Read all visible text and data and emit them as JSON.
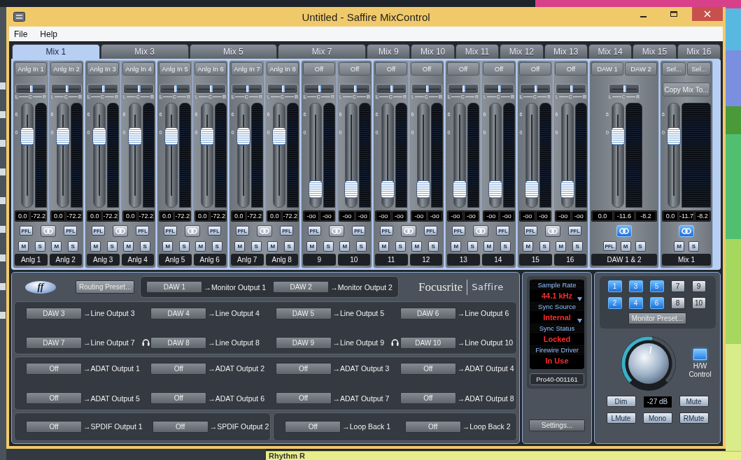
{
  "window": {
    "title": "Untitled - Saffire MixControl"
  },
  "menu": [
    "File",
    "Help"
  ],
  "tabs": [
    {
      "label": "Mix 1",
      "selected": true
    },
    {
      "label": "Mix 3",
      "selected": false
    },
    {
      "label": "Mix 5",
      "selected": false
    },
    {
      "label": "Mix 7",
      "selected": false
    },
    {
      "label": "Mix 9",
      "selected": false
    },
    {
      "label": "Mix 10",
      "selected": false
    },
    {
      "label": "Mix 11",
      "selected": false
    },
    {
      "label": "Mix 12",
      "selected": false
    },
    {
      "label": "Mix 13",
      "selected": false
    },
    {
      "label": "Mix 14",
      "selected": false
    },
    {
      "label": "Mix 15",
      "selected": false
    },
    {
      "label": "Mix 16",
      "selected": false
    }
  ],
  "mixer": {
    "groups": [
      {
        "kind": "pair",
        "linked": false,
        "strips": [
          {
            "sources": [
              "Anlg In 1"
            ],
            "pan": {
              "level": 0.5
            },
            "pan_labels": [
              "L",
              "C",
              "R"
            ],
            "fader_scale": [
              "6",
              "0"
            ],
            "level": 0.72,
            "readouts": [
              "0.0",
              "-72.2"
            ],
            "pfl": "PFL",
            "mute": "M",
            "solo": "S",
            "name": "Anlg 1"
          },
          {
            "sources": [
              "Anlg In 2"
            ],
            "pan": {
              "level": 0.5
            },
            "pan_labels": [
              "L",
              "C",
              "R"
            ],
            "fader_scale": [
              "6",
              "0"
            ],
            "level": 0.72,
            "readouts": [
              "0.0",
              "-72.2"
            ],
            "pfl": "PFL",
            "mute": "M",
            "solo": "S",
            "name": "Anlg 2"
          }
        ]
      },
      {
        "kind": "pair",
        "linked": false,
        "strips": [
          {
            "sources": [
              "Anlg In 3"
            ],
            "pan": {
              "level": 0.5
            },
            "pan_labels": [
              "L",
              "C",
              "R"
            ],
            "fader_scale": [
              "6",
              "0"
            ],
            "level": 0.72,
            "readouts": [
              "0.0",
              "-72.2"
            ],
            "pfl": "PFL",
            "mute": "M",
            "solo": "S",
            "name": "Anlg 3"
          },
          {
            "sources": [
              "Anlg In 4"
            ],
            "pan": {
              "level": 0.5
            },
            "pan_labels": [
              "L",
              "C",
              "R"
            ],
            "fader_scale": [
              "6",
              "0"
            ],
            "level": 0.72,
            "readouts": [
              "0.0",
              "-72.2"
            ],
            "pfl": "PFL",
            "mute": "M",
            "solo": "S",
            "name": "Anlg 4"
          }
        ]
      },
      {
        "kind": "pair",
        "linked": false,
        "strips": [
          {
            "sources": [
              "Anlg In 5"
            ],
            "pan": {
              "level": 0.5
            },
            "pan_labels": [
              "L",
              "C",
              "R"
            ],
            "fader_scale": [
              "6",
              "0"
            ],
            "level": 0.72,
            "readouts": [
              "0.0",
              "-72.2"
            ],
            "pfl": "PFL",
            "mute": "M",
            "solo": "S",
            "name": "Anlg 5"
          },
          {
            "sources": [
              "Anlg In 6"
            ],
            "pan": {
              "level": 0.5
            },
            "pan_labels": [
              "L",
              "C",
              "R"
            ],
            "fader_scale": [
              "6",
              "0"
            ],
            "level": 0.72,
            "readouts": [
              "0.0",
              "-72.2"
            ],
            "pfl": "PFL",
            "mute": "M",
            "solo": "S",
            "name": "Anlg 6"
          }
        ]
      },
      {
        "kind": "pair",
        "linked": false,
        "strips": [
          {
            "sources": [
              "Anlg In 7"
            ],
            "pan": {
              "level": 0.5
            },
            "pan_labels": [
              "L",
              "C",
              "R"
            ],
            "fader_scale": [
              "6",
              "0"
            ],
            "level": 0.72,
            "readouts": [
              "0.0",
              "-72.2"
            ],
            "pfl": "PFL",
            "mute": "M",
            "solo": "S",
            "name": "Anlg 7"
          },
          {
            "sources": [
              "Anlg In 8"
            ],
            "pan": {
              "level": 0.5
            },
            "pan_labels": [
              "L",
              "C",
              "R"
            ],
            "fader_scale": [
              "6",
              "0"
            ],
            "level": 0.72,
            "readouts": [
              "0.0",
              "-72.2"
            ],
            "pfl": "PFL",
            "mute": "M",
            "solo": "S",
            "name": "Anlg 8"
          }
        ]
      },
      {
        "kind": "pair",
        "linked": false,
        "strips": [
          {
            "sources": [
              "Off"
            ],
            "pan": {
              "level": 0.5
            },
            "pan_labels": [
              "L",
              "C",
              "R"
            ],
            "fader_scale": [
              "6",
              "0"
            ],
            "level": 0.1,
            "readouts": [
              "-oo",
              "-oo"
            ],
            "pfl": "PFL",
            "mute": "M",
            "solo": "S",
            "name": "9"
          },
          {
            "sources": [
              "Off"
            ],
            "pan": {
              "level": 0.5
            },
            "pan_labels": [
              "L",
              "C",
              "R"
            ],
            "fader_scale": [
              "6",
              "0"
            ],
            "level": 0.1,
            "readouts": [
              "-oo",
              "-oo"
            ],
            "pfl": "PFL",
            "mute": "M",
            "solo": "S",
            "name": "10"
          }
        ]
      },
      {
        "kind": "pair",
        "linked": false,
        "strips": [
          {
            "sources": [
              "Off"
            ],
            "pan": {
              "level": 0.5
            },
            "pan_labels": [
              "L",
              "C",
              "R"
            ],
            "fader_scale": [
              "6",
              "0"
            ],
            "level": 0.1,
            "readouts": [
              "-oo",
              "-oo"
            ],
            "pfl": "PFL",
            "mute": "M",
            "solo": "S",
            "name": "11"
          },
          {
            "sources": [
              "Off"
            ],
            "pan": {
              "level": 0.5
            },
            "pan_labels": [
              "L",
              "C",
              "R"
            ],
            "fader_scale": [
              "6",
              "0"
            ],
            "level": 0.1,
            "readouts": [
              "-oo",
              "-oo"
            ],
            "pfl": "PFL",
            "mute": "M",
            "solo": "S",
            "name": "12"
          }
        ]
      },
      {
        "kind": "pair",
        "linked": false,
        "strips": [
          {
            "sources": [
              "Off"
            ],
            "pan": {
              "level": 0.5
            },
            "pan_labels": [
              "L",
              "C",
              "R"
            ],
            "fader_scale": [
              "6",
              "0"
            ],
            "level": 0.1,
            "readouts": [
              "-oo",
              "-oo"
            ],
            "pfl": "PFL",
            "mute": "M",
            "solo": "S",
            "name": "13"
          },
          {
            "sources": [
              "Off"
            ],
            "pan": {
              "level": 0.5
            },
            "pan_labels": [
              "L",
              "C",
              "R"
            ],
            "fader_scale": [
              "6",
              "0"
            ],
            "level": 0.1,
            "readouts": [
              "-oo",
              "-oo"
            ],
            "pfl": "PFL",
            "mute": "M",
            "solo": "S",
            "name": "14"
          }
        ]
      },
      {
        "kind": "pair",
        "linked": false,
        "strips": [
          {
            "sources": [
              "Off"
            ],
            "pan": {
              "level": 0.5
            },
            "pan_labels": [
              "L",
              "C",
              "R"
            ],
            "fader_scale": [
              "6",
              "0"
            ],
            "level": 0.1,
            "readouts": [
              "-oo",
              "-oo"
            ],
            "pfl": "PFL",
            "mute": "M",
            "solo": "S",
            "name": "15"
          },
          {
            "sources": [
              "Off"
            ],
            "pan": {
              "level": 0.5
            },
            "pan_labels": [
              "L",
              "C",
              "R"
            ],
            "fader_scale": [
              "6",
              "0"
            ],
            "level": 0.1,
            "readouts": [
              "-oo",
              "-oo"
            ],
            "pfl": "PFL",
            "mute": "M",
            "solo": "S",
            "name": "16"
          }
        ]
      },
      {
        "kind": "daw",
        "linked": true,
        "strips": [
          {
            "sources": [
              "DAW 1",
              "DAW 2"
            ],
            "pan": {
              "level": 0.5
            },
            "pan_labels": [
              "L",
              "C",
              "R"
            ],
            "fader_scale": [
              "6",
              "0"
            ],
            "level": 0.72,
            "readouts": [
              "0.0",
              "-11.6",
              "-8.2"
            ],
            "pfl": "PFL",
            "mute": "M",
            "solo": "S",
            "name": "DAW 1 & 2"
          }
        ]
      },
      {
        "kind": "mix",
        "linked": true,
        "strips": [
          {
            "sources": [
              "Sel...",
              "Sel..."
            ],
            "copy": "Copy Mix To...",
            "fader_scale": [
              "6",
              "0"
            ],
            "level": 0.72,
            "readouts": [
              "0.0",
              "-11.7",
              "-8.2"
            ],
            "mute": "M",
            "solo": "S",
            "name": "Mix 1"
          }
        ]
      }
    ]
  },
  "routing": {
    "logo_mark": "ff",
    "preset_button": "Routing Preset...",
    "monitor_routes": [
      {
        "source": "DAW 1",
        "target": "→Monitor Output 1"
      },
      {
        "source": "DAW 2",
        "target": "→Monitor Output 2"
      }
    ],
    "brand": {
      "name": "Focusrite",
      "product": "Saffire"
    },
    "groups": [
      {
        "routes": [
          {
            "source": "DAW 3",
            "target": "→Line Output 3",
            "headphones": false
          },
          {
            "source": "DAW 4",
            "target": "→Line Output 4",
            "headphones": false
          },
          {
            "source": "DAW 5",
            "target": "→Line Output 5",
            "headphones": false
          },
          {
            "source": "DAW 6",
            "target": "→Line Output 6",
            "headphones": false
          },
          {
            "source": "DAW 7",
            "target": "→Line Output 7",
            "headphones": false
          },
          {
            "source": "DAW 8",
            "target": "→Line Output 8",
            "headphones": true
          },
          {
            "source": "DAW 9",
            "target": "→Line Output 9",
            "headphones": false
          },
          {
            "source": "DAW 10",
            "target": "→Line Output 10",
            "headphones": true
          }
        ]
      },
      {
        "routes": [
          {
            "source": "Off",
            "target": "→ADAT Output 1"
          },
          {
            "source": "Off",
            "target": "→ADAT Output 2"
          },
          {
            "source": "Off",
            "target": "→ADAT Output 3"
          },
          {
            "source": "Off",
            "target": "→ADAT Output 4"
          },
          {
            "source": "Off",
            "target": "→ADAT Output 5"
          },
          {
            "source": "Off",
            "target": "→ADAT Output 6"
          },
          {
            "source": "Off",
            "target": "→ADAT Output 7"
          },
          {
            "source": "Off",
            "target": "→ADAT Output 8"
          }
        ]
      },
      {
        "routes": [
          {
            "source": "Off",
            "target": "→SPDIF Output 1"
          },
          {
            "source": "Off",
            "target": "→SPDIF Output 2"
          }
        ]
      },
      {
        "routes": [
          {
            "source": "Off",
            "target": "→Loop Back 1"
          },
          {
            "source": "Off",
            "target": "→Loop Back 2"
          }
        ]
      }
    ]
  },
  "status": {
    "items": [
      {
        "label": "Sample Rate",
        "value": "44.1 kHz",
        "dropdown": true
      },
      {
        "label": "Sync Source",
        "value": "Internal",
        "dropdown": true
      },
      {
        "label": "Sync Status",
        "value": "Locked",
        "dropdown": false
      },
      {
        "label": "Firewire Driver",
        "value": "In Use",
        "dropdown": false
      }
    ],
    "device": "Pro40-001161",
    "settings_button": "Settings..."
  },
  "monitor": {
    "speakers": [
      {
        "label": "1",
        "selected": true
      },
      {
        "label": "3",
        "selected": true
      },
      {
        "label": "5",
        "selected": true
      },
      {
        "label": "7",
        "selected": false
      },
      {
        "label": "9",
        "selected": false
      },
      {
        "label": "2",
        "selected": true
      },
      {
        "label": "4",
        "selected": true
      },
      {
        "label": "6",
        "selected": true
      },
      {
        "label": "8",
        "selected": false
      },
      {
        "label": "10",
        "selected": false
      }
    ],
    "preset_button": "Monitor Preset...",
    "knob": {
      "level": 0.53
    },
    "hw_control": {
      "label": "H/W Control",
      "on": true
    },
    "buttons": [
      {
        "kind": "button",
        "label": "Dim"
      },
      {
        "kind": "readout",
        "label": "-27 dB"
      },
      {
        "kind": "button",
        "label": "Mute"
      },
      {
        "kind": "button",
        "label": "LMute"
      },
      {
        "kind": "button",
        "label": "Mono"
      },
      {
        "kind": "button",
        "label": "RMute"
      }
    ]
  },
  "background": {
    "clip": "Rhythm R"
  }
}
